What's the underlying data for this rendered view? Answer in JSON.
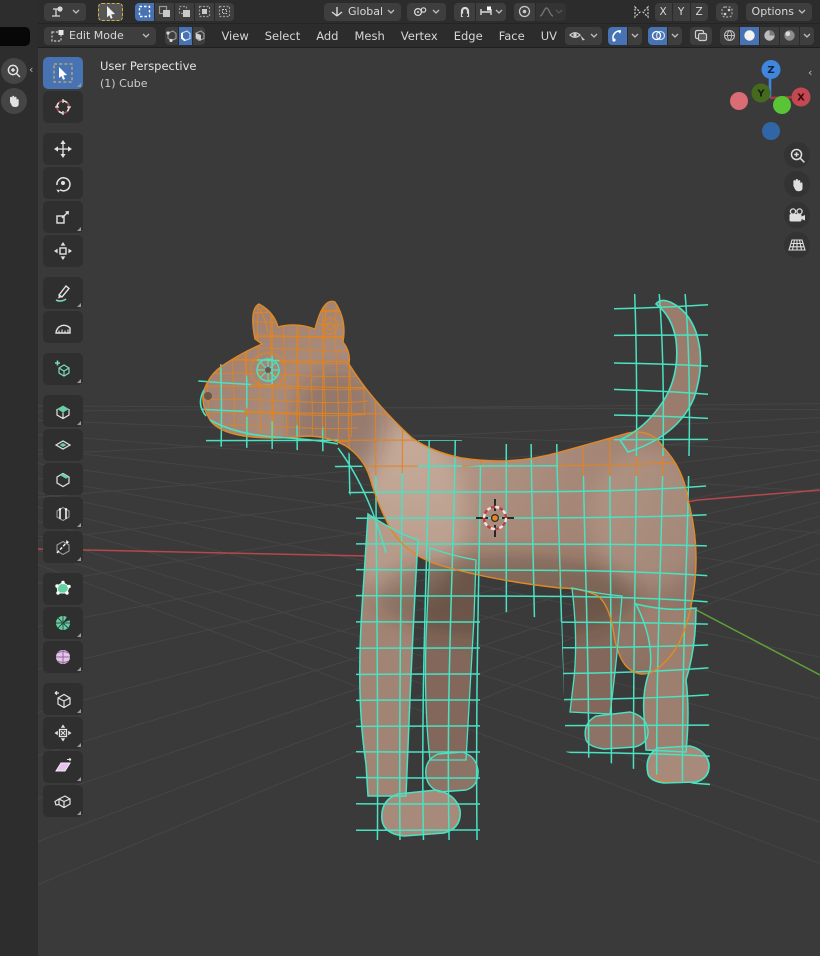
{
  "app": {
    "name": "Blender 3D Viewport"
  },
  "tool_settings_bar": {
    "tool_dropdown_icon": "tweak-tool-icon",
    "active_tool_icon": "cursor-arrow-icon",
    "select_modes": [
      "set",
      "extend",
      "subtract",
      "invert",
      "intersect"
    ],
    "active_select_mode": "set",
    "orientation_label": "Global",
    "pivot_icon": "pivot-point-icon",
    "snap_icon": "magnet-icon",
    "snap_with_icon": "increment-snap-icon",
    "proportional_icon": "proportional-editing-icon",
    "falloff_icon": "smooth-falloff-icon",
    "mirror_icon": "mirror-icon",
    "mirror_axes": {
      "x": "X",
      "y": "Y",
      "z": "Z"
    },
    "symmetry_icon": "snap-symmetry-icon",
    "options_label": "Options"
  },
  "viewport_header": {
    "mode_icon": "edit-mode-icon",
    "mode_label": "Edit Mode",
    "select_mode_icons": [
      "vertex-select-icon",
      "edge-select-icon",
      "face-select-icon"
    ],
    "active_select_mode": "edge",
    "menus": [
      "View",
      "Select",
      "Add",
      "Mesh",
      "Vertex",
      "Edge",
      "Face",
      "UV"
    ],
    "visibility_icon": "show-hide-icon",
    "gizmos_icon": "gizmos-icon",
    "overlays_icon": "overlays-icon",
    "xray_icon": "toggle-xray-icon",
    "shading_icons": [
      "wireframe-shading-icon",
      "solid-shading-icon",
      "material-preview-icon",
      "rendered-shading-icon"
    ],
    "active_shading": "solid"
  },
  "toolbar": {
    "active_tool": "Tweak",
    "tools": [
      "Tweak",
      "Cursor",
      "Move",
      "Rotate",
      "Scale",
      "Transform",
      "Annotate",
      "Measure",
      "Add Cube",
      "Extrude Region",
      "Inset Faces",
      "Bevel",
      "Loop Cut",
      "Knife",
      "Poly Build",
      "Spin",
      "Smooth",
      "Edge Slide",
      "Shrink/Fatten",
      "Shear",
      "Rip Region"
    ]
  },
  "viewport": {
    "overlay": {
      "view_label": "User Perspective",
      "object_label": "(1) Cube"
    },
    "gizmo_axis_labels": {
      "z": "Z",
      "y": "Y",
      "x": "X"
    },
    "nav_controls": [
      "zoom-icon",
      "pan-hand-icon",
      "camera-view-icon",
      "grid-ortho-icon"
    ],
    "side_panel_controls": [
      "zoom-icon",
      "pan-hand-icon"
    ]
  },
  "colors": {
    "accent_blue": "#4772b3",
    "header_bg": "#2c2c2c",
    "viewport_bg": "#3a3a3a",
    "selected_edge": "#49e2c3",
    "edge": "#e28420",
    "mesh_surface": "#a78a7a",
    "axis_x": "#b3484d",
    "axis_y": "#5f9f3a",
    "gizmo_z": "#3f86dc"
  }
}
